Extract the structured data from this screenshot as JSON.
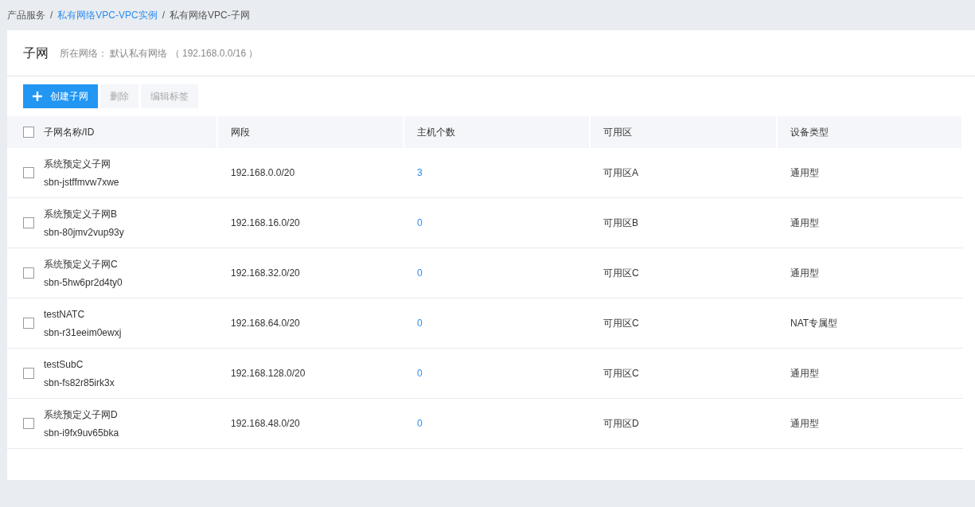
{
  "breadcrumb": [
    {
      "label": "产品服务",
      "link": false
    },
    {
      "label": "私有网络VPC-VPC实例",
      "link": true
    },
    {
      "label": "私有网络VPC-子网",
      "link": false
    }
  ],
  "breadcrumb_separator": "/",
  "header": {
    "title": "子网",
    "subtitle": "所在网络： 默认私有网络 （ 192.168.0.0/16 ）"
  },
  "toolbar": [
    {
      "label": "创建子网",
      "kind": "primary",
      "disabled": false
    },
    {
      "label": "删除",
      "kind": "secondary",
      "disabled": true
    },
    {
      "label": "编辑标签",
      "kind": "secondary",
      "disabled": true
    }
  ],
  "table": {
    "select_all": {
      "checked": false
    },
    "columns": [
      "子网名称/ID",
      "网段",
      "主机个数",
      "可用区",
      "设备类型"
    ],
    "rows": [
      {
        "checked": false,
        "name": "系统预定义子网",
        "id": "sbn-jstffmvw7xwe",
        "cidr": "192.168.0.0/20",
        "hosts": "3",
        "zone": "可用区A",
        "device_type": "通用型"
      },
      {
        "checked": false,
        "name": "系统预定义子网B",
        "id": "sbn-80jmv2vup93y",
        "cidr": "192.168.16.0/20",
        "hosts": "0",
        "zone": "可用区B",
        "device_type": "通用型"
      },
      {
        "checked": false,
        "name": "系统预定义子网C",
        "id": "sbn-5hw6pr2d4ty0",
        "cidr": "192.168.32.0/20",
        "hosts": "0",
        "zone": "可用区C",
        "device_type": "通用型"
      },
      {
        "checked": false,
        "name": "testNATC",
        "id": "sbn-r31eeim0ewxj",
        "cidr": "192.168.64.0/20",
        "hosts": "0",
        "zone": "可用区C",
        "device_type": "NAT专属型"
      },
      {
        "checked": false,
        "name": "testSubC",
        "id": "sbn-fs82r85irk3x",
        "cidr": "192.168.128.0/20",
        "hosts": "0",
        "zone": "可用区C",
        "device_type": "通用型"
      },
      {
        "checked": false,
        "name": "系统预定义子网D",
        "id": "sbn-i9fx9uv65bka",
        "cidr": "192.168.48.0/20",
        "hosts": "0",
        "zone": "可用区D",
        "device_type": "通用型"
      }
    ]
  }
}
